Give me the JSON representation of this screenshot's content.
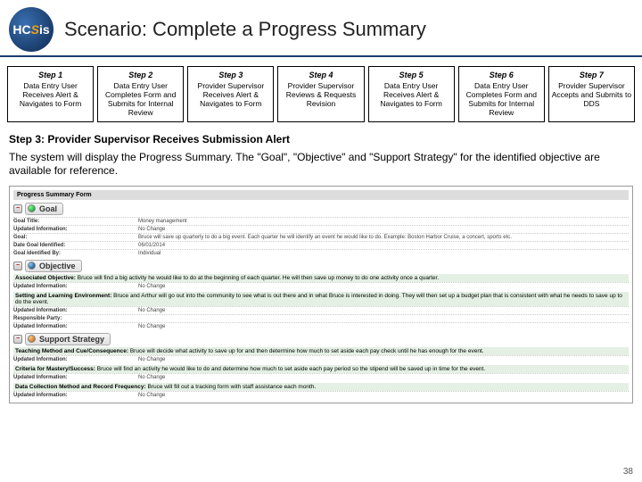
{
  "logo": {
    "text_pre": "HC",
    "text_s": "S",
    "text_post": "is"
  },
  "title": "Scenario: Complete a Progress Summary",
  "steps": [
    {
      "label": "Step 1",
      "desc": "Data Entry User Receives Alert & Navigates to Form"
    },
    {
      "label": "Step 2",
      "desc": "Data Entry User Completes Form and Submits for Internal Review"
    },
    {
      "label": "Step 3",
      "desc": "Provider Supervisor Receives Alert & Navigates to Form"
    },
    {
      "label": "Step 4",
      "desc": "Provider Supervisor Reviews & Requests Revision"
    },
    {
      "label": "Step 5",
      "desc": "Data Entry User Receives Alert & Navigates to Form"
    },
    {
      "label": "Step 6",
      "desc": "Data Entry User Completes Form and Submits for Internal Review"
    },
    {
      "label": "Step 7",
      "desc": "Provider Supervisor Accepts and Submits to DDS"
    }
  ],
  "subtitle": "Step 3: Provider Supervisor Receives Submission Alert",
  "body_text": "The system will display the Progress Summary. The \"Goal\", \"Objective\" and \"Support Strategy\" for the identified objective are available for reference.",
  "form": {
    "title": "Progress Summary Form",
    "goal_section": {
      "label": "Goal",
      "rows": [
        {
          "lab": "Goal Title:",
          "val": "Money management"
        },
        {
          "lab": "Updated Information:",
          "val": "No Change"
        },
        {
          "lab": "Goal:",
          "val": "Bruce will save up quarterly to do a big event. Each quarter he will identify an event he would like to do. Example: Boston Harbor Cruise, a concert, sports etc."
        },
        {
          "lab": "Date Goal Identified:",
          "val": "06/01/2014"
        },
        {
          "lab": "Goal Identified By:",
          "val": "Individual"
        }
      ]
    },
    "objective_section": {
      "label": "Objective",
      "rows": [
        {
          "sub": "Associated Objective:",
          "text": "Bruce will find a big activity he would like to do at the beginning of each quarter. He will then save up money to do one activity once a quarter."
        },
        {
          "lab": "Updated Information:",
          "val": "No Change"
        },
        {
          "sub": "Setting and Learning Environment:",
          "text": "Bruce and Arthur will go out into the community to see what is out there and in what Bruce is interested in doing. They will then set up a budget plan that is consistent with what he needs to save up to do the event."
        },
        {
          "lab": "Updated Information:",
          "val": "No Change"
        },
        {
          "lab": "Responsible Party:",
          "val": ""
        },
        {
          "lab": "Updated Information:",
          "val": "No Change"
        }
      ]
    },
    "support_section": {
      "label": "Support Strategy",
      "rows": [
        {
          "sub": "Teaching Method and Cue/Consequence:",
          "text": "Bruce will decide what activity to save up for and then determine how much to set aside each pay check until he has enough for the event."
        },
        {
          "lab": "Updated Information:",
          "val": "No Change"
        },
        {
          "sub": "Criteria for Mastery/Success:",
          "text": "Bruce will find an activity he would like to do and determine how much to set aside each pay period so the stipend will be saved up in time for the event."
        },
        {
          "lab": "Updated Information:",
          "val": "No Change"
        },
        {
          "sub": "Data Collection Method and Record Frequency:",
          "text": "Bruce will fill out a tracking form with staff assistance each month."
        },
        {
          "lab": "Updated Information:",
          "val": "No Change"
        }
      ]
    }
  },
  "page_number": "38"
}
